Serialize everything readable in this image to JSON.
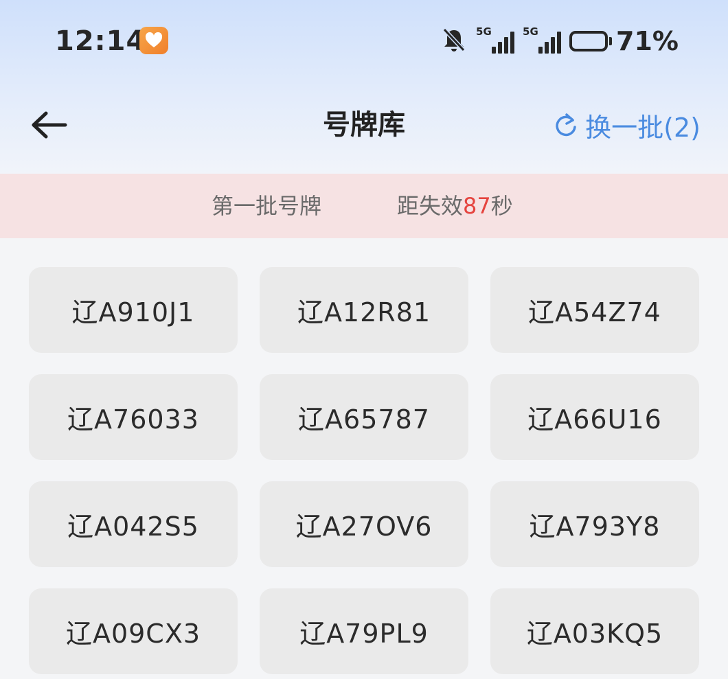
{
  "status_bar": {
    "time": "12:14",
    "signal_1_label": "5G",
    "signal_2_label": "5G",
    "battery_level": 0.71,
    "battery_percent": "71%",
    "icons": [
      "health-app-icon",
      "bell-muted-icon",
      "signal-icon",
      "battery-icon"
    ]
  },
  "header": {
    "title": "号牌库",
    "back_icon": "arrow-left-icon",
    "refresh_label": "换一批(2)",
    "refresh_icon": "refresh-icon"
  },
  "info_bar": {
    "batch_label": "第一批号牌",
    "countdown_prefix": "距失效",
    "countdown_value": "87",
    "countdown_suffix": "秒"
  },
  "plates": [
    "辽A910J1",
    "辽A12R81",
    "辽A54Z74",
    "辽A76033",
    "辽A65787",
    "辽A66U16",
    "辽A042S5",
    "辽A27OV6",
    "辽A793Y8",
    "辽A09CX3",
    "辽A79PL9",
    "辽A03KQ5"
  ],
  "colors": {
    "accent": "#4a8be0",
    "countdown": "#e5443f",
    "info_bar_bg": "#f6e2e3",
    "plate_bg": "#eaeaea"
  }
}
